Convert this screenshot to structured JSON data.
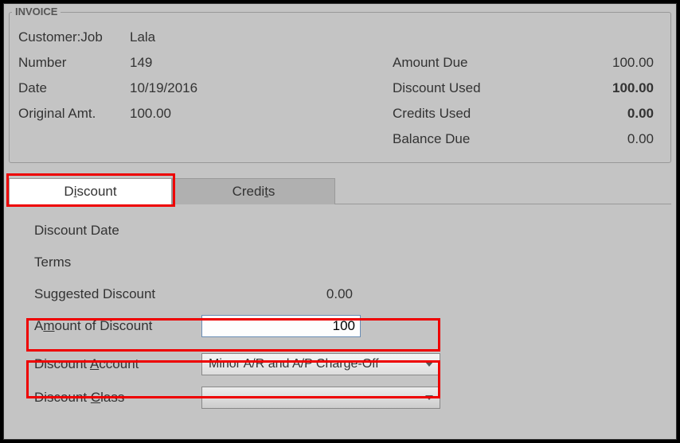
{
  "panel": {
    "title": "INVOICE"
  },
  "info": {
    "customer_label": "Customer:Job",
    "customer_value": "Lala",
    "number_label": "Number",
    "number_value": "149",
    "date_label": "Date",
    "date_value": "10/19/2016",
    "orig_label": "Original Amt.",
    "orig_value": "100.00",
    "amount_due_label": "Amount Due",
    "amount_due_value": "100.00",
    "discount_used_label": "Discount Used",
    "discount_used_value": "100.00",
    "credits_used_label": "Credits Used",
    "credits_used_value": "0.00",
    "balance_due_label": "Balance Due",
    "balance_due_value": "0.00"
  },
  "tabs": {
    "discount": "Discount",
    "credits": "Credits"
  },
  "form": {
    "discount_date_label": "Discount Date",
    "terms_label": "Terms",
    "suggested_label": "Suggested Discount",
    "suggested_value": "0.00",
    "amount_label_pre": "A",
    "amount_label_u": "m",
    "amount_label_post": "ount of Discount",
    "amount_value": "100",
    "account_label_pre": "Discount ",
    "account_label_u": "A",
    "account_label_post": "ccount",
    "account_value": "Minor A/R and A/P Charge-Off",
    "class_label_pre": "Discount ",
    "class_label_u": "C",
    "class_label_post": "lass",
    "class_value": ""
  }
}
